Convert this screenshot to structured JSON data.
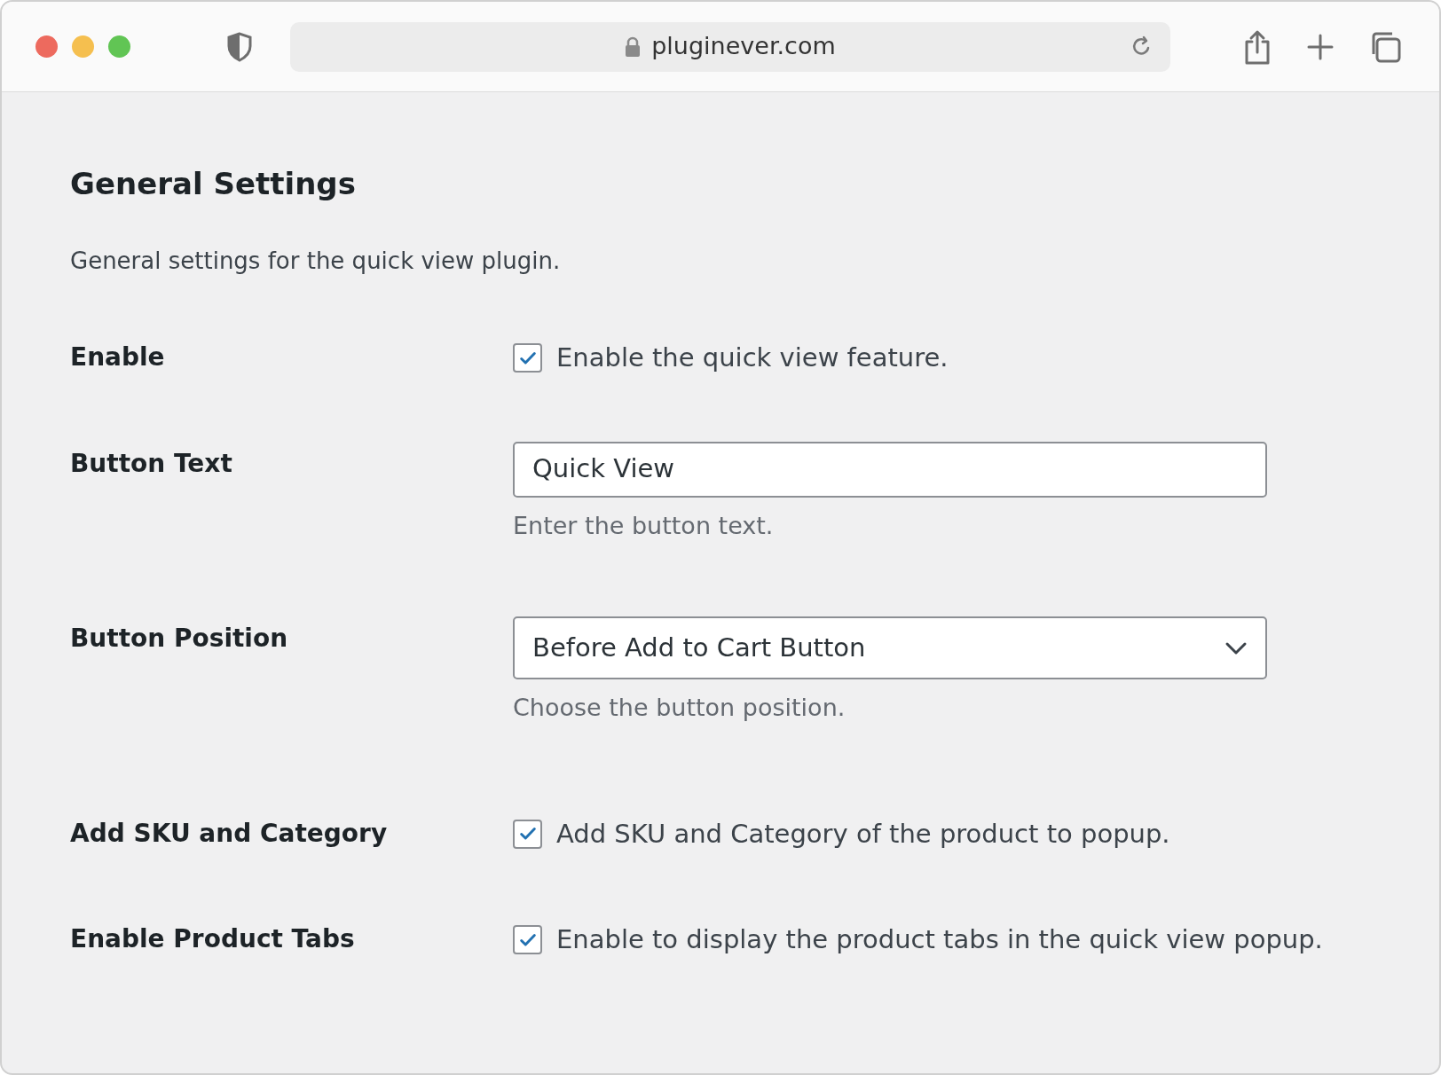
{
  "browser": {
    "url": "pluginever.com"
  },
  "page": {
    "title": "General Settings",
    "description": "General settings for the quick view plugin."
  },
  "settings": [
    {
      "kind": "checkbox",
      "label": "Enable",
      "checked": true,
      "text": "Enable the quick view feature."
    },
    {
      "kind": "text",
      "label": "Button Text",
      "value": "Quick View",
      "help": "Enter the button text."
    },
    {
      "kind": "select",
      "label": "Button Position",
      "value": "Before Add to Cart Button",
      "help": "Choose the button position."
    },
    {
      "kind": "checkbox",
      "label": "Add SKU and Category",
      "checked": true,
      "text": "Add SKU and Category of the product to popup."
    },
    {
      "kind": "checkbox",
      "label": "Enable Product Tabs",
      "checked": true,
      "text": "Enable to display the product tabs in the quick view popup."
    }
  ]
}
